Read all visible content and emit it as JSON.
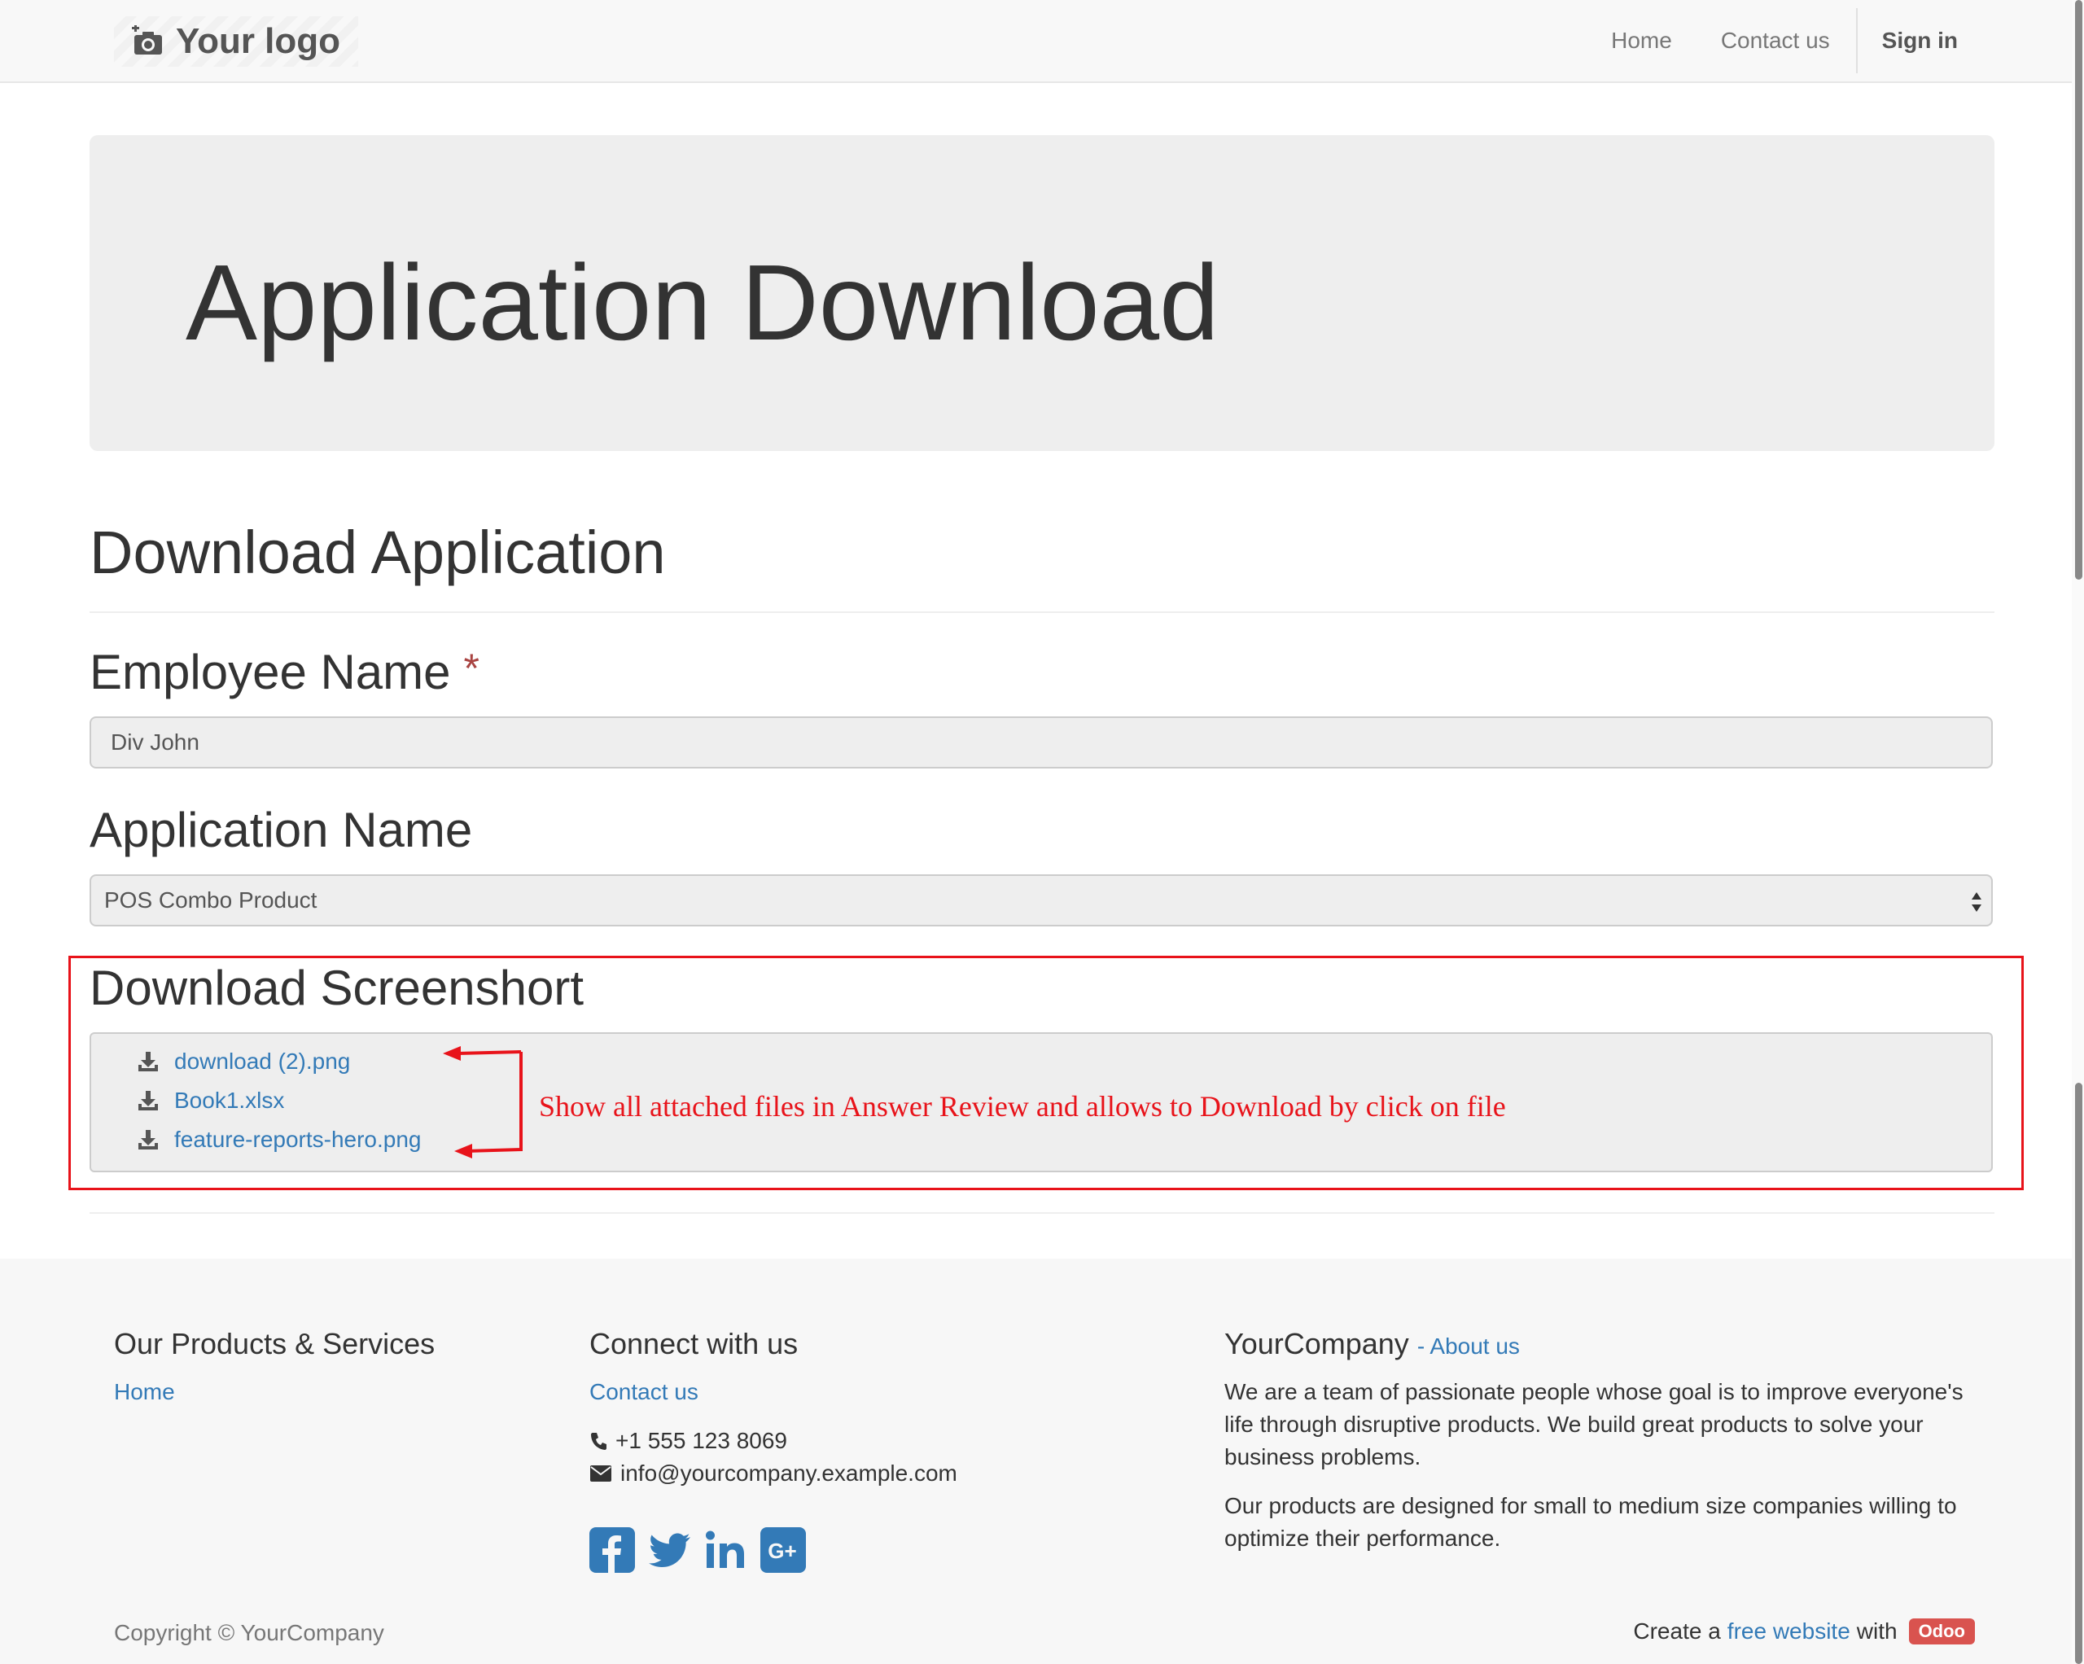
{
  "navbar": {
    "logo_text": "Your logo",
    "logo_icon": "camera-icon",
    "links": [
      "Home",
      "Contact us"
    ],
    "signin": "Sign in"
  },
  "hero": {
    "title": "Application Download"
  },
  "form": {
    "section_title": "Download Application",
    "employee_label": "Employee Name",
    "required_mark": "*",
    "employee_value": "Div John",
    "application_label": "Application Name",
    "application_value": "POS Combo Product",
    "screenshot_label": "Download Screenshort",
    "files": [
      "download (2).png",
      "Book1.xlsx",
      "feature-reports-hero.png"
    ]
  },
  "annotation": {
    "text": "Show all attached files in Answer Review and allows to Download by click on file",
    "color": "#e8131a"
  },
  "footer": {
    "col1_title": "Our Products & Services",
    "col1_link": "Home",
    "col2_title": "Connect with us",
    "col2_link": "Contact us",
    "phone": "+1 555 123 8069",
    "email": "info@yourcompany.example.com",
    "social_icons": [
      "facebook-icon",
      "twitter-icon",
      "linkedin-icon",
      "google-plus-icon"
    ],
    "col3_title": "YourCompany",
    "col3_about": "- About us",
    "about_p1": "We are a team of passionate people whose goal is to improve everyone's life through disruptive products. We build great products to solve your business problems.",
    "about_p2": "Our products are designed for small to medium size companies willing to optimize their performance.",
    "copyright": "Copyright © YourCompany",
    "create_prefix": "Create a",
    "create_link": "free website",
    "create_with": "with",
    "odoo": "Odoo"
  },
  "colors": {
    "link": "#337ab7",
    "annotation": "#e8131a",
    "required": "#a94442",
    "odoo": "#d9534f"
  }
}
